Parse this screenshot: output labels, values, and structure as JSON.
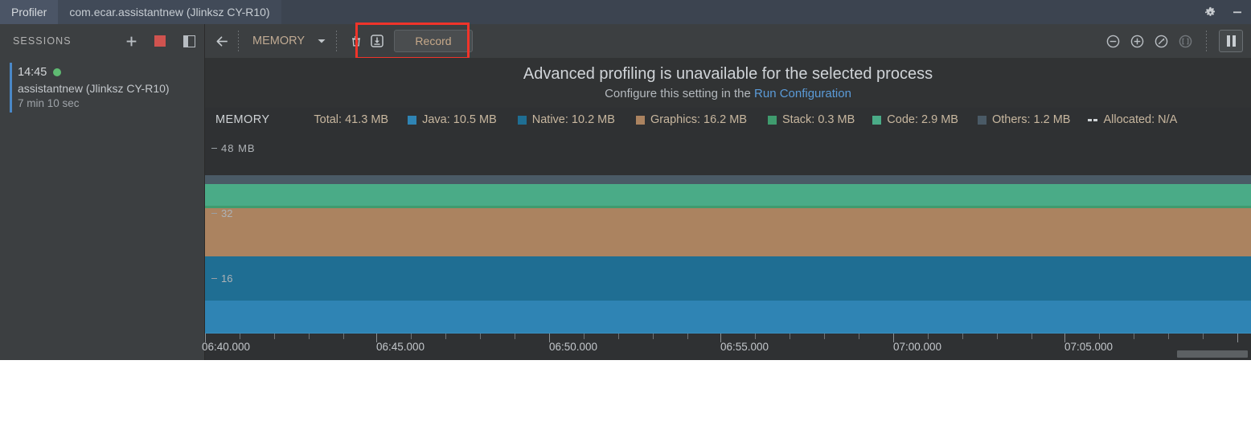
{
  "window": {
    "tabs": [
      {
        "label": "Profiler",
        "state": "active"
      },
      {
        "label": "com.ecar.assistantnew (Jlinksz CY-R10)",
        "state": "process"
      }
    ],
    "settings_icon": "gear-icon",
    "minimize_icon": "minimize-icon"
  },
  "sessions": {
    "title": "SESSIONS",
    "add_label": "+",
    "stop_label": "stop-icon",
    "split_label": "split-pane-icon",
    "items": [
      {
        "time": "14:45",
        "name": "assistantnew (Jlinksz CY-R10)",
        "duration": "7 min 10 sec",
        "live": true
      }
    ]
  },
  "toolbar": {
    "back_label": "back-arrow",
    "stage_selector": "MEMORY",
    "dropdown_label": "chevron-down",
    "trash_label": "trash-icon",
    "export_label": "export-icon",
    "record_label": "Record",
    "zoom_out_label": "zoom-out-icon",
    "zoom_in_label": "zoom-in-icon",
    "reset_zoom_label": "reset-zoom-icon",
    "attach_label": "attach-live-icon",
    "pause_label": "pause-icon",
    "highlight_color": "#f0342a"
  },
  "notice": {
    "main": "Advanced profiling is unavailable for the selected process",
    "sub_prefix": "Configure this setting in the ",
    "link": "Run Configuration"
  },
  "legend": {
    "title": "MEMORY",
    "total": "Total: 41.3 MB",
    "items": [
      {
        "label": "Java: 10.5 MB",
        "color": "#2f84b4"
      },
      {
        "label": "Native: 10.2 MB",
        "color": "#1f6e93"
      },
      {
        "label": "Graphics: 16.2 MB",
        "color": "#ab8360"
      },
      {
        "label": "Stack: 0.3 MB",
        "color": "#3f9b6e"
      },
      {
        "label": "Code: 2.9 MB",
        "color": "#4aab87"
      },
      {
        "label": "Others: 1.2 MB",
        "color": "#4a5a66"
      }
    ],
    "allocated": "Allocated: N/A"
  },
  "chart_data": {
    "type": "area",
    "title": "MEMORY",
    "ylabel": "MB",
    "xlabel": "",
    "ylim": [
      0,
      56
    ],
    "yticks": [
      {
        "value": 48,
        "label": "48 MB"
      },
      {
        "value": 32,
        "label": "32"
      },
      {
        "value": 16,
        "label": "16"
      }
    ],
    "grid": false,
    "legend_position": "top",
    "stack_order": [
      "Java",
      "Native",
      "Graphics",
      "Stack",
      "Code",
      "Others"
    ],
    "x": [
      "06:40.000",
      "06:45.000",
      "06:50.000",
      "06:55.000",
      "07:00.000",
      "07:05.000"
    ],
    "xticklabels": [
      "06:40.000",
      "06:45.000",
      "06:50.000",
      "06:55.000",
      "07:00.000",
      "07:05.000"
    ],
    "series": [
      {
        "name": "Java",
        "color": "#2f84b4",
        "value": 10.5,
        "values": [
          10.5,
          10.5,
          10.5,
          10.5,
          10.5,
          10.5
        ]
      },
      {
        "name": "Native",
        "color": "#1f6e93",
        "value": 10.2,
        "values": [
          10.2,
          10.2,
          10.2,
          10.2,
          10.2,
          10.2
        ]
      },
      {
        "name": "Graphics",
        "color": "#ab8360",
        "value": 16.2,
        "values": [
          16.2,
          16.2,
          16.2,
          16.2,
          16.2,
          16.2
        ]
      },
      {
        "name": "Stack",
        "color": "#3f9b6e",
        "value": 0.3,
        "values": [
          0.3,
          0.3,
          0.3,
          0.3,
          0.3,
          0.3
        ]
      },
      {
        "name": "Code",
        "color": "#4aab87",
        "value": 2.9,
        "values": [
          2.9,
          2.9,
          2.9,
          2.9,
          2.9,
          2.9
        ]
      },
      {
        "name": "Others",
        "color": "#4a5a66",
        "value": 1.2,
        "values": [
          1.2,
          1.2,
          1.2,
          1.2,
          1.2,
          1.2
        ]
      }
    ],
    "total": 41.3
  },
  "axis_labels": {
    "y48": "48 MB",
    "y32": "32",
    "y16": "16",
    "t0": "06:40.000",
    "t1": "06:45.000",
    "t2": "06:50.000",
    "t3": "06:55.000",
    "t4": "07:00.000",
    "t5": "07:05.000"
  }
}
